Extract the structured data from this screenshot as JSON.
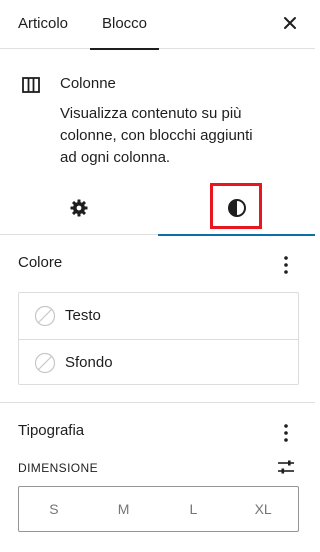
{
  "tabs": {
    "articolo": "Articolo",
    "blocco": "Blocco"
  },
  "close_icon": "close-icon",
  "block": {
    "icon": "columns-icon",
    "title": "Colonne",
    "description": "Visualizza contenuto su più colonne, con blocchi aggiunti ad ogni colonna."
  },
  "subtabs": {
    "settings_icon": "gear-icon",
    "styles_icon": "contrast-icon",
    "active": "styles",
    "active_color": "#0b6fa8",
    "highlight_color": "#e8161e"
  },
  "color_section": {
    "title": "Colore",
    "items": [
      {
        "label": "Testo"
      },
      {
        "label": "Sfondo"
      }
    ]
  },
  "typography_section": {
    "title": "Tipografia",
    "dimension_label": "DIMENSIONE",
    "sizes": [
      "S",
      "M",
      "L",
      "XL"
    ]
  }
}
